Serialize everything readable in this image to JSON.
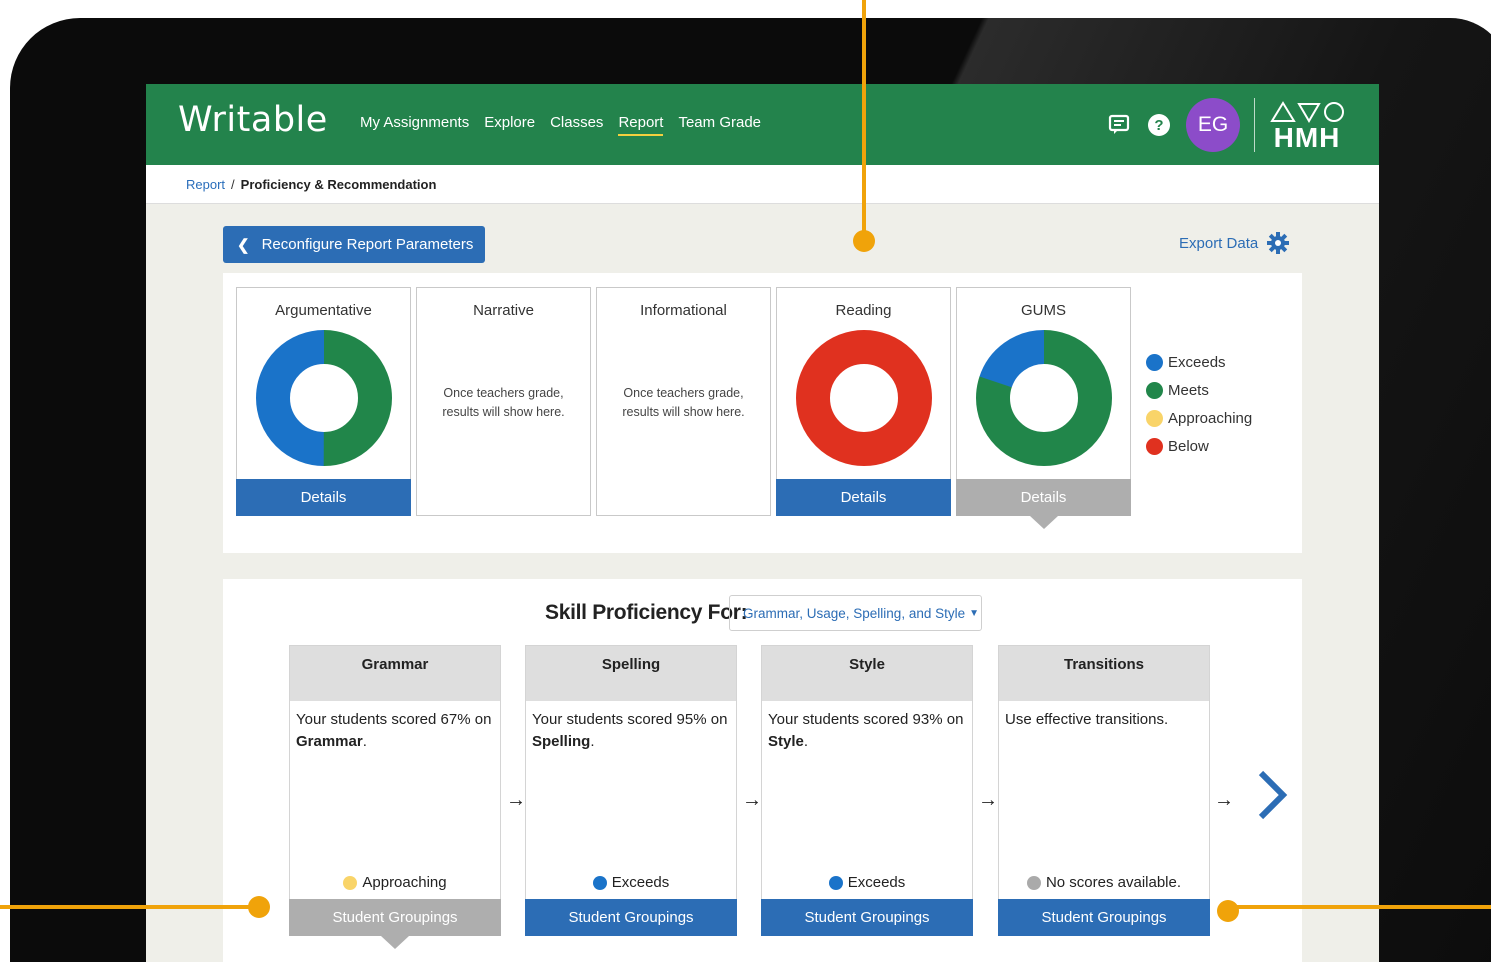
{
  "app": {
    "logo": "Writable",
    "nav": [
      "My Assignments",
      "Explore",
      "Classes",
      "Report",
      "Team Grade"
    ],
    "active_nav": "Report",
    "user_initials": "EG",
    "brand": "HMH"
  },
  "breadcrumb": {
    "parent": "Report",
    "separator": "/",
    "current": "Proficiency & Recommendation"
  },
  "toolbar": {
    "reconfigure_label": "Reconfigure Report Parameters",
    "export_label": "Export Data"
  },
  "categories": [
    {
      "title": "Argumentative",
      "has_data": true,
      "button": "Details",
      "button_state": "blue",
      "distribution": {
        "exceeds": 0.5,
        "meets": 0.5,
        "approaching": 0,
        "below": 0
      }
    },
    {
      "title": "Narrative",
      "has_data": false,
      "empty_line1": "Once teachers grade,",
      "empty_line2": "results will show here."
    },
    {
      "title": "Informational",
      "has_data": false,
      "empty_line1": "Once teachers grade,",
      "empty_line2": "results will show here."
    },
    {
      "title": "Reading",
      "has_data": true,
      "button": "Details",
      "button_state": "blue",
      "distribution": {
        "exceeds": 0,
        "meets": 0,
        "approaching": 0,
        "below": 1.0
      }
    },
    {
      "title": "GUMS",
      "has_data": true,
      "button": "Details",
      "button_state": "gray",
      "distribution": {
        "exceeds": 0.2,
        "meets": 0.8,
        "approaching": 0,
        "below": 0
      }
    }
  ],
  "legend": [
    {
      "label": "Exceeds",
      "color": "#1a73c9"
    },
    {
      "label": "Meets",
      "color": "#21864a"
    },
    {
      "label": "Approaching",
      "color": "#f9d469"
    },
    {
      "label": "Below",
      "color": "#e0311f"
    }
  ],
  "skill": {
    "heading": "Skill Proficiency For:",
    "selected": "Grammar, Usage, Spelling, and Style",
    "cards": [
      {
        "title": "Grammar",
        "text": "Your students scored 67% on",
        "bold": "Grammar",
        "suffix": ".",
        "status": "Approaching",
        "status_color": "#f9d469",
        "button": "Student Groupings",
        "button_state": "gray"
      },
      {
        "title": "Spelling",
        "text": "Your students scored 95% on",
        "bold": "Spelling",
        "suffix": ".",
        "status": "Exceeds",
        "status_color": "#1a73c9",
        "button": "Student Groupings",
        "button_state": "blue"
      },
      {
        "title": "Style",
        "text": "Your students scored 93% on",
        "bold": "Style",
        "suffix": ".",
        "status": "Exceeds",
        "status_color": "#1a73c9",
        "button": "Student Groupings",
        "button_state": "blue"
      },
      {
        "title": "Transitions",
        "text": "Use effective transitions.",
        "bold": "",
        "suffix": "",
        "status": "No scores available.",
        "status_color": "#aaaaaa",
        "button": "Student Groupings",
        "button_state": "blue"
      }
    ]
  },
  "colors": {
    "header_green": "#23834c",
    "accent_blue": "#2c6db5",
    "callout_orange": "#f0a30a"
  }
}
